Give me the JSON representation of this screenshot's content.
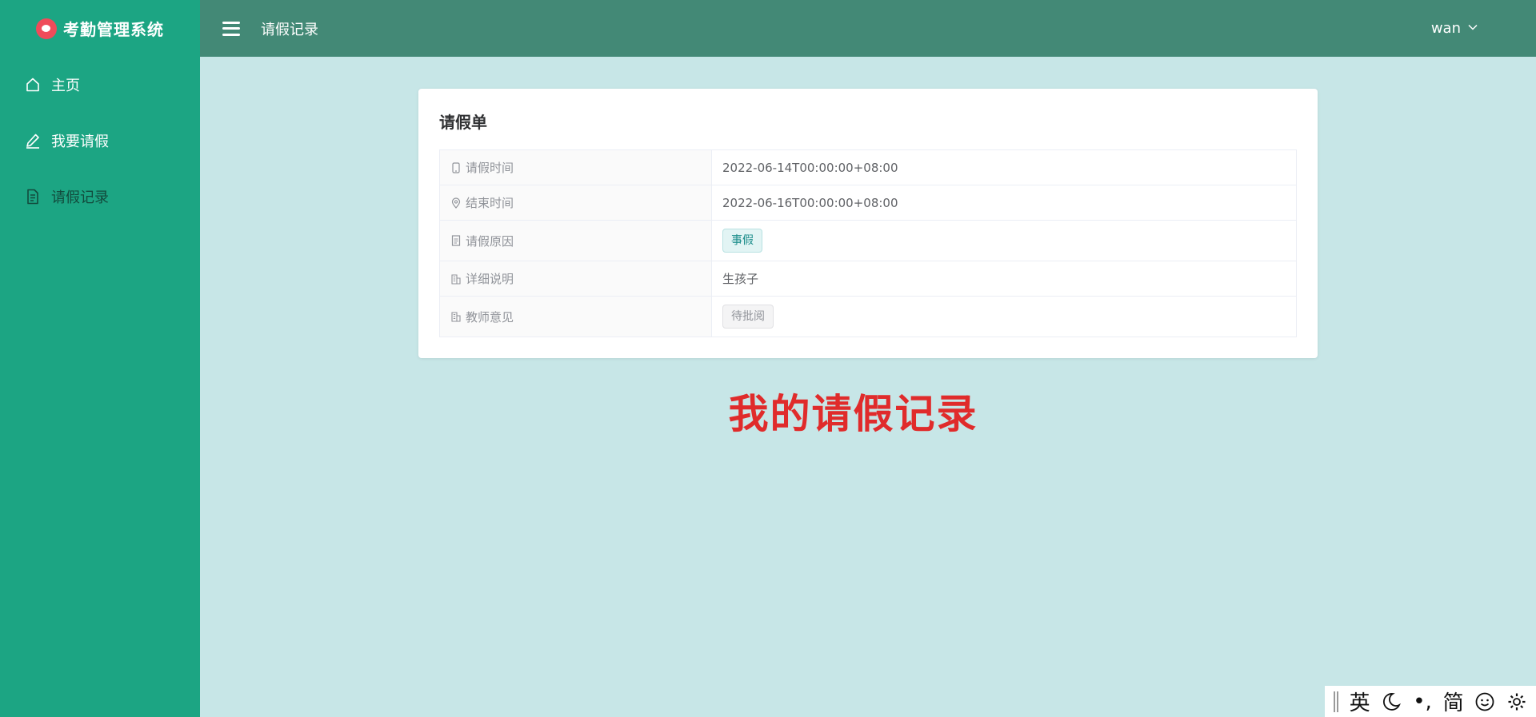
{
  "app": {
    "title": "考勤管理系统"
  },
  "sidebar": {
    "items": [
      {
        "label": "主页",
        "icon": "home-icon"
      },
      {
        "label": "我要请假",
        "icon": "edit-icon"
      },
      {
        "label": "请假记录",
        "icon": "document-icon",
        "active": true
      }
    ]
  },
  "header": {
    "title": "请假记录",
    "user": "wan"
  },
  "card": {
    "title": "请假单",
    "rows": [
      {
        "label": "请假时间",
        "icon": "mobile-icon",
        "value": "2022-06-14T00:00:00+08:00"
      },
      {
        "label": "结束时间",
        "icon": "location-icon",
        "value": "2022-06-16T00:00:00+08:00"
      },
      {
        "label": "请假原因",
        "icon": "document-icon",
        "value": "事假",
        "tag": true
      },
      {
        "label": "详细说明",
        "icon": "office-building-icon",
        "value": "生孩子"
      },
      {
        "label": "教师意见",
        "icon": "office-building-icon",
        "value": "待批阅",
        "tag": true
      }
    ]
  },
  "caption": "我的请假记录",
  "ime": {
    "lang": "英",
    "punct": "•,",
    "mode": "简"
  },
  "colors": {
    "sidebar": "#1ca583",
    "header": "#438976",
    "background": "#c7e6e7",
    "caption": "#e02b2b"
  }
}
